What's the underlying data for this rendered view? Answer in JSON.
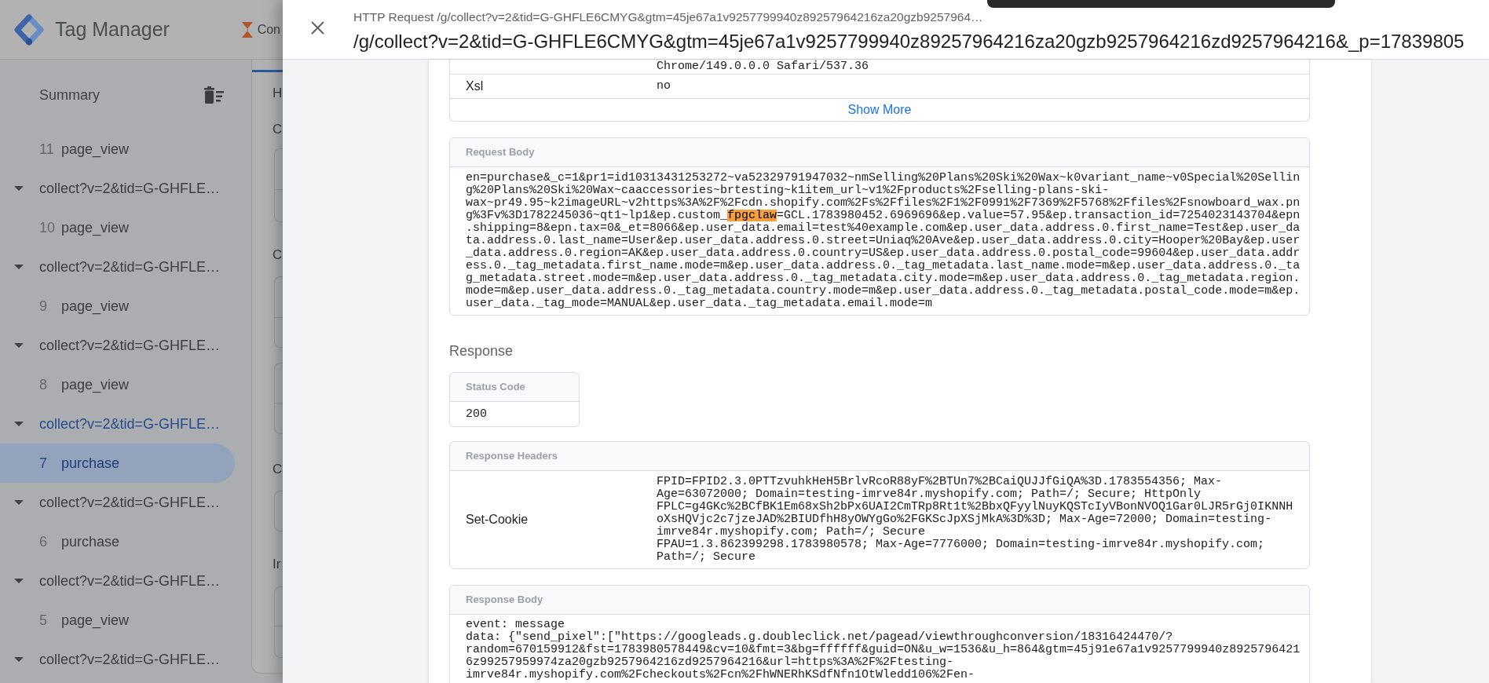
{
  "app_header": {
    "product": "Tag Manager",
    "container": "Con"
  },
  "sidebar": {
    "title": "Summary",
    "items": [
      {
        "kind": "event",
        "number": "11",
        "name": "page_view",
        "selected": false
      },
      {
        "kind": "request",
        "label": "collect?v=2&tid=G-GHFLE…",
        "expanded": true,
        "selected": false,
        "children": [
          {
            "kind": "event",
            "number": "10",
            "name": "page_view",
            "selected": false
          }
        ]
      },
      {
        "kind": "request",
        "label": "collect?v=2&tid=G-GHFLE…",
        "expanded": true,
        "selected": false,
        "children": [
          {
            "kind": "event",
            "number": "9",
            "name": "page_view",
            "selected": false
          }
        ]
      },
      {
        "kind": "request",
        "label": "collect?v=2&tid=G-GHFLE…",
        "expanded": true,
        "selected": false,
        "children": [
          {
            "kind": "event",
            "number": "8",
            "name": "page_view",
            "selected": false
          }
        ]
      },
      {
        "kind": "request",
        "label": "collect?v=2&tid=G-GHFLE…",
        "expanded": true,
        "selected": true,
        "children": [
          {
            "kind": "event",
            "number": "7",
            "name": "purchase",
            "selected": true
          }
        ]
      },
      {
        "kind": "request",
        "label": "collect?v=2&tid=G-GHFLE…",
        "expanded": true,
        "selected": false,
        "children": [
          {
            "kind": "event",
            "number": "6",
            "name": "purchase",
            "selected": false
          }
        ]
      },
      {
        "kind": "request",
        "label": "collect?v=2&tid=G-GHFLE…",
        "expanded": true,
        "selected": false,
        "children": [
          {
            "kind": "event",
            "number": "5",
            "name": "page_view",
            "selected": false
          }
        ]
      },
      {
        "kind": "request",
        "label": "collect?v=2&tid=G-GHFLE…",
        "expanded": true,
        "selected": false
      }
    ]
  },
  "main_panel": {
    "heading": "H",
    "section_labels": [
      "C",
      "C",
      "C",
      "Ir"
    ]
  },
  "sheet": {
    "subtitle": "HTTP Request /g/collect?v=2&tid=G-GHFLE6CMYG&gtm=45je67a1v9257799940z89257964216za20gzb9257964…",
    "title": "/g/collect?v=2&tid=G-GHFLE6CMYG&gtm=45je67a1v9257799940z89257964216za20gzb9257964216zd9257964216&_p=17839805"
  },
  "request_details": {
    "rows": [
      {
        "value": "Chrome/149.0.0.0 Safari/537.36"
      },
      {
        "label": "Xsl",
        "value": "no"
      }
    ],
    "show_more": "Show More"
  },
  "request_body": {
    "title": "Request Body",
    "segments": [
      {
        "text": "en=purchase&_c=1&pr1=id10313431253272~va52329791947032~nmSelling%20Plans%20Ski%20Wax~k0variant_name~v0Special%20Selling%20Plans%20Ski%20Wax~caaccessories~brtesting~k1item_url~v1%2Fproducts%2Fselling-plans-ski-wax~pr49.95~k2imageURL~v2https%3A%2F%2Fcdn.shopify.com%2Fs%2Ffiles%2F1%2F0991%2F7369%2F5768%2Ffiles%2Fsnowboard_wax.png%3Fv%3D1782245036~qt1~lp1&ep.custom_",
        "highlighted": false
      },
      {
        "text": "fpgclaw",
        "highlighted": true
      },
      {
        "text": "=GCL.1783980452.6969696&ep.value=57.95&ep.transaction_id=7254023143704&epn.shipping=8&epn.tax=0&_et=8066&ep.user_data.email=test%40example.com&ep.user_data.address.0.first_name=Test&ep.user_data.address.0.last_name=User&ep.user_data.address.0.street=Uniaq%20Ave&ep.user_data.address.0.city=Hooper%20Bay&ep.user_data.address.0.region=AK&ep.user_data.address.0.country=US&ep.user_data.address.0.postal_code=99604&ep.user_data.address.0._tag_metadata.first_name.mode=m&ep.user_data.address.0._tag_metadata.last_name.mode=m&ep.user_data.address.0._tag_metadata.street.mode=m&ep.user_data.address.0._tag_metadata.city.mode=m&ep.user_data.address.0._tag_metadata.region.mode=m&ep.user_data.address.0._tag_metadata.country.mode=m&ep.user_data.address.0._tag_metadata.postal_code.mode=m&ep.user_data._tag_mode=MANUAL&ep.user_data._tag_metadata.email.mode=m",
        "highlighted": false
      }
    ]
  },
  "response": {
    "heading": "Response",
    "status": {
      "title": "Status Code",
      "value": "200"
    },
    "headers": {
      "title": "Response Headers",
      "rows": [
        {
          "name": "Set-Cookie",
          "value": "FPID=FPID2.3.0PTTzvuhkHeH5BrlvRcoR88yF%2BTUn7%2BCaiQUJJfGiQA%3D.1783554356; Max-Age=63072000; Domain=testing-imrve84r.myshopify.com; Path=/; Secure; HttpOnly\nFPLC=g4GKc%2BCfBK1Em68xSh2bPx6UAI2CmTRp8Rt1t%2BbxQFyylNuyKQSTcIyVBonNVOQ1Gar0LJR5rGj0IKNNHoXsHQVjc2c7jzeJAD%2BIUDfhH8yOWYgGo%2FGKScJpXSjMkA%3D%3D; Max-Age=72000; Domain=testing-imrve84r.myshopify.com; Path=/; Secure\nFPAU=1.3.862399298.1783980578; Max-Age=7776000; Domain=testing-imrve84r.myshopify.com; Path=/; Secure"
        }
      ]
    },
    "body": {
      "title": "Response Body",
      "text": "event: message\ndata: {\"send_pixel\":[\"https://googleads.g.doubleclick.net/pagead/viewthroughconversion/18316424470/?random=670159912&fst=1783980578449&cv=10&fmt=3&bg=ffffff&guid=ON&u_w=1536&u_h=864&gtm=45j91e67a1v9257799940z89257964216z99257959974za20gzb9257964216zd9257964216&url=https%3A%2F%2Ftesting-imrve84r.myshopify.com%2Fcheckouts%2Fcn%2FhWNERhKSdfNfn1OtWledd106%2Fen-"
    }
  }
}
